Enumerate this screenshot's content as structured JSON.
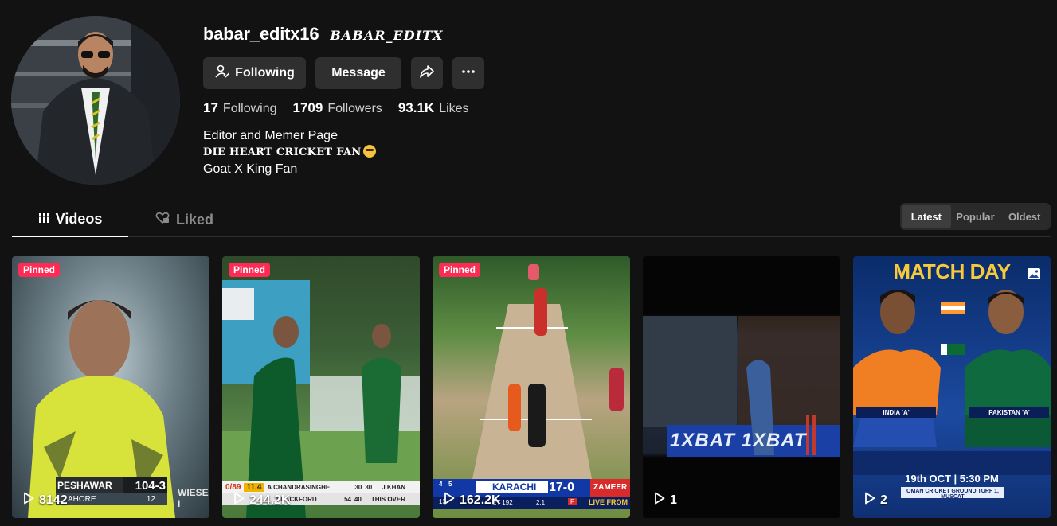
{
  "profile": {
    "username": "babar_editx16",
    "nickname": "BABAR_EDITX",
    "following_button": "Following",
    "message_button": "Message",
    "stats": {
      "following_count": "17",
      "following_label": "Following",
      "followers_count": "1709",
      "followers_label": "Followers",
      "likes_count": "93.1K",
      "likes_label": "Likes"
    },
    "bio": [
      "Editor and Memer Page",
      "DIE HEART CRICKET FAN",
      "Goat X King Fan"
    ]
  },
  "tabs": {
    "videos": "Videos",
    "liked": "Liked"
  },
  "sort": [
    "Latest",
    "Popular",
    "Oldest"
  ],
  "videos": [
    {
      "pinned": "Pinned",
      "views": "8142",
      "overlay": {
        "team": "PESHAWAR",
        "score": "104-3",
        "sub": "AHORE",
        "sub_num": "12",
        "extra": "WIESE I"
      }
    },
    {
      "pinned": "Pinned",
      "views": "244.2K",
      "overlay": {
        "left": "0/89",
        "mid": "11.4",
        "p1": "A CHANDRASINGHE",
        "p1a": "30",
        "p1b": "30",
        "p2": "BLACKFORD",
        "p2a": "54",
        "p2b": "40",
        "r1": "J KHAN",
        "r2": "THIS OVER"
      }
    },
    {
      "pinned": "Pinned",
      "views": "162.2K",
      "overlay": {
        "team": "KARACHI",
        "score": "17-0",
        "a": "4",
        "b": "5",
        "c": "13",
        "target": "ET 192",
        "rr": "2.1",
        "p": "P",
        "name": "ZAMEER",
        "live": "LIVE FROM"
      }
    },
    {
      "pinned": "",
      "views": "1",
      "overlay": {
        "sponsor": "1XBAT 1XBAT"
      }
    },
    {
      "pinned": "",
      "views": "2",
      "overlay": {
        "title": "MATCH DAY",
        "left_team": "INDIA 'A'",
        "right_team": "PAKISTAN 'A'",
        "time": "19th OCT | 5:30 PM",
        "venue": "OMAN CRICKET GROUND TURF 1, MUSCAT"
      }
    }
  ]
}
